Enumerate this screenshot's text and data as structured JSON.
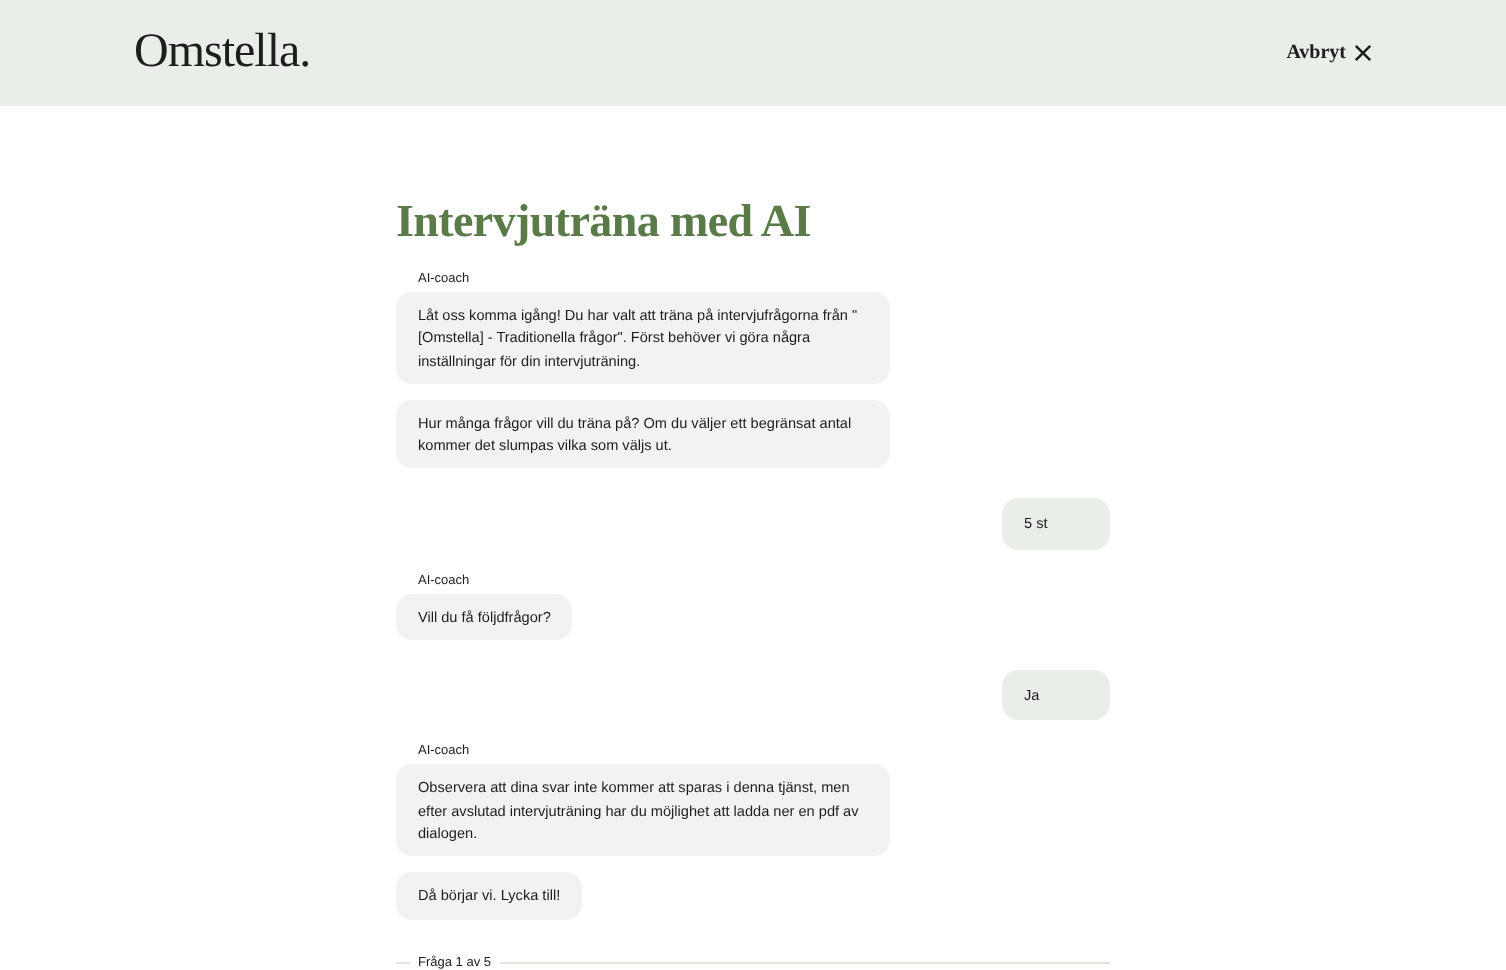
{
  "header": {
    "logo": "Omstella.",
    "cancel": "Avbryt"
  },
  "title": "Intervjuträna med AI",
  "messages": [
    {
      "kind": "coach",
      "label": "AI-coach",
      "text": "Låt oss komma igång! Du har valt att träna på intervjufrågorna från \" [Omstella] - Traditionella frågor\". Först behöver vi göra några inställningar för din intervjuträning."
    },
    {
      "kind": "coach",
      "text": "Hur många frågor vill du träna på? Om du väljer ett begränsat antal kommer det slumpas vilka som väljs ut."
    },
    {
      "kind": "user",
      "text": "5 st"
    },
    {
      "kind": "coach",
      "label": "AI-coach",
      "text": "Vill du få följdfrågor?"
    },
    {
      "kind": "user",
      "text": "Ja"
    },
    {
      "kind": "coach",
      "label": "AI-coach",
      "text": "Observera att dina svar inte kommer att sparas i denna tjänst, men efter avslutad intervjuträning har du möjlighet att ladda ner en pdf av dialogen."
    },
    {
      "kind": "coach",
      "text": "Då börjar vi. Lycka till!"
    }
  ],
  "progress": "Fråga 1 av 5"
}
